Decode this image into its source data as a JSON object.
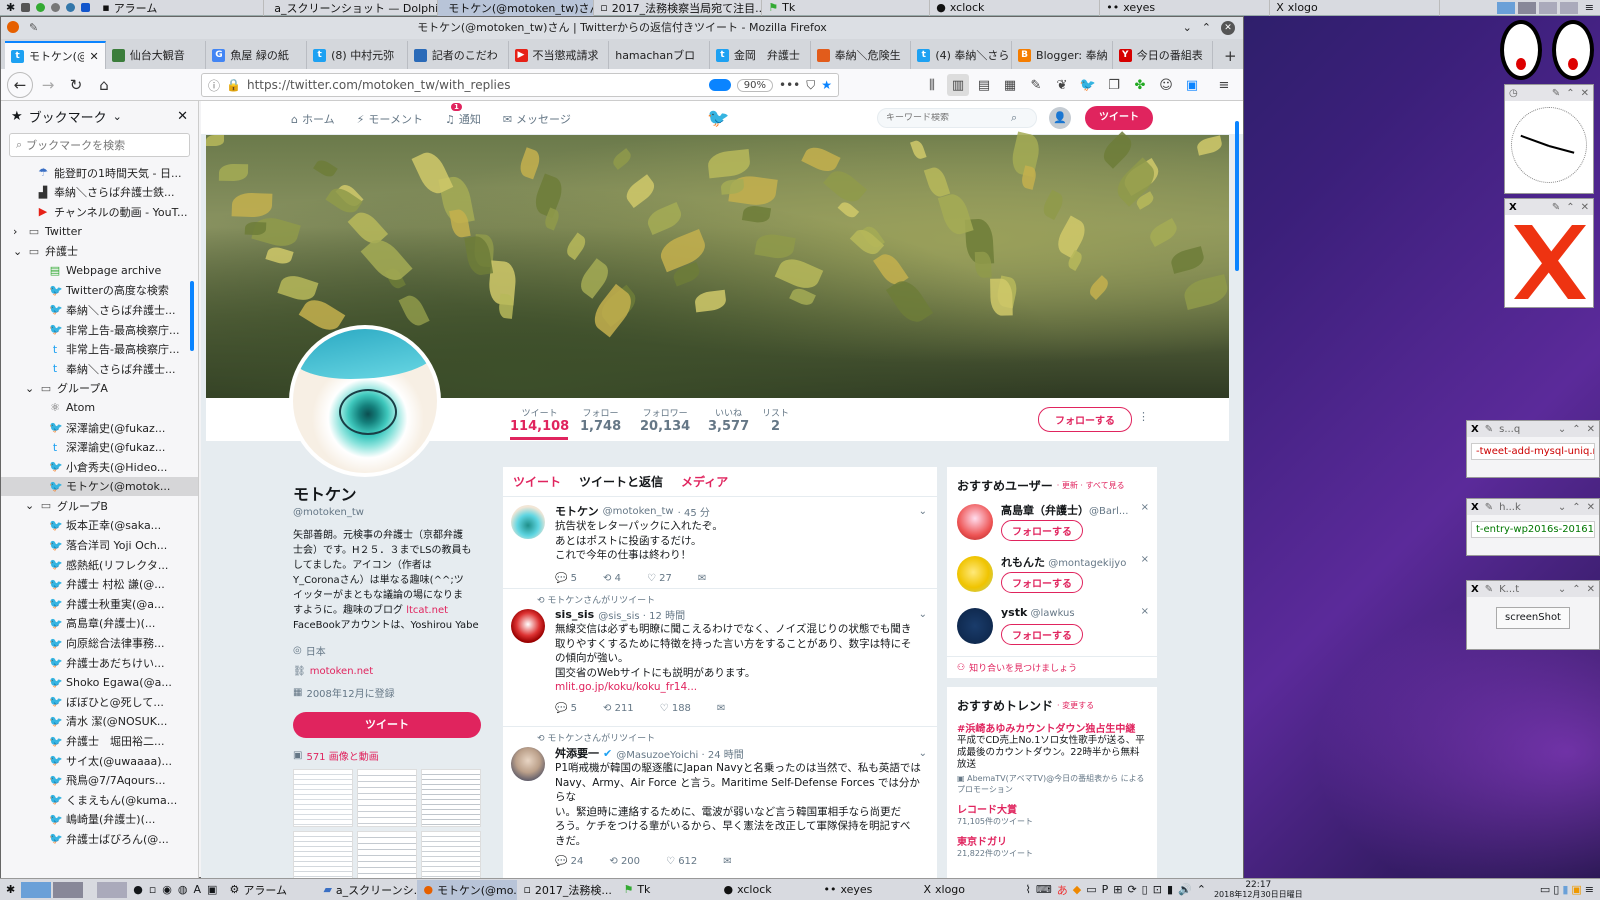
{
  "top_panel": {
    "tasks": [
      {
        "label": "アラーム"
      },
      {
        "label": "a_スクリーンショット — Dolphin"
      },
      {
        "label": "モトケン(@motoken_tw)さん ..."
      },
      {
        "label": "2017_法務検察当局宛て注目..."
      },
      {
        "label": "Tk"
      },
      {
        "label": "xclock"
      },
      {
        "label": "xeyes"
      },
      {
        "label": "xlogo"
      }
    ]
  },
  "window": {
    "title": "モトケン(@motoken_tw)さん | Twitterからの返信付きツイート - Mozilla Firefox"
  },
  "tabs": [
    {
      "label": "モトケン(@",
      "color": "#1da1f2"
    },
    {
      "label": "仙台大観音",
      "color": "#3b7d3b"
    },
    {
      "label": "魚屋 緑の紙",
      "color": "#4285f4"
    },
    {
      "label": "(8) 中村元弥",
      "color": "#1da1f2"
    },
    {
      "label": "記者のこだわ",
      "color": "#2a6ab8"
    },
    {
      "label": "不当懲戒請求",
      "color": "#e62117"
    },
    {
      "label": "hamachanブロ",
      "color": "#888888"
    },
    {
      "label": "金岡　弁護士",
      "color": "#1da1f2"
    },
    {
      "label": "奉納＼危険生",
      "color": "#e25c1b"
    },
    {
      "label": "(4) 奉納＼さら",
      "color": "#1da1f2"
    },
    {
      "label": "Blogger: 奉納",
      "color": "#f57d00"
    },
    {
      "label": "今日の番組表",
      "color": "#d60000"
    }
  ],
  "url": {
    "value": "https://twitter.com/motoken_tw/with_replies",
    "zoom": "90%"
  },
  "sidebar": {
    "title": "ブックマーク",
    "search_placeholder": "ブックマークを検索",
    "items": [
      {
        "label": "能登町の1時間天気 - 日...",
        "indent": 3,
        "icon": "weather"
      },
      {
        "label": "奉納＼さらば弁護士鉄...",
        "indent": 3,
        "icon": "chart"
      },
      {
        "label": "チャンネルの動画 - YouT...",
        "indent": 3,
        "icon": "youtube"
      },
      {
        "label": "Twitter",
        "indent": 2,
        "icon": "folder",
        "arrow": "›"
      },
      {
        "label": "弁護士",
        "indent": 2,
        "icon": "folder",
        "arrow": "⌄"
      },
      {
        "label": "Webpage archive",
        "indent": 4,
        "icon": "archive"
      },
      {
        "label": "Twitterの高度な検索",
        "indent": 4,
        "icon": "twitter"
      },
      {
        "label": "奉納＼さらば弁護士...",
        "indent": 4,
        "icon": "twitter"
      },
      {
        "label": "非常上告-最高検察庁...",
        "indent": 4,
        "icon": "twitter"
      },
      {
        "label": "非常上告-最高検察庁...",
        "indent": 4,
        "icon": "twitter-blue"
      },
      {
        "label": "奉納＼さらば弁護士...",
        "indent": 4,
        "icon": "twitter-blue"
      },
      {
        "label": "グループA",
        "indent": 3,
        "icon": "folder",
        "arrow": "⌄"
      },
      {
        "label": "Atom",
        "indent": 4,
        "icon": "atom"
      },
      {
        "label": "深澤諭史(@fukaz...",
        "indent": 4,
        "icon": "twitter"
      },
      {
        "label": "深澤諭史(@fukaz...",
        "indent": 4,
        "icon": "twitter-blue"
      },
      {
        "label": "小倉秀夫(@Hideo...",
        "indent": 4,
        "icon": "twitter"
      },
      {
        "label": "モトケン(@motok...",
        "indent": 4,
        "icon": "twitter",
        "selected": true
      },
      {
        "label": "グループB",
        "indent": 3,
        "icon": "folder",
        "arrow": "⌄"
      },
      {
        "label": "坂本正幸(@saka...",
        "indent": 4,
        "icon": "twitter"
      },
      {
        "label": "落合洋司 Yoji Och...",
        "indent": 4,
        "icon": "twitter"
      },
      {
        "label": "感熱紙(リフレクタ...",
        "indent": 4,
        "icon": "twitter"
      },
      {
        "label": "弁護士 村松 謙(@...",
        "indent": 4,
        "icon": "twitter"
      },
      {
        "label": "弁護士秋重実(@a...",
        "indent": 4,
        "icon": "twitter"
      },
      {
        "label": "高島章(弁護士)(...",
        "indent": 4,
        "icon": "twitter"
      },
      {
        "label": "向原総合法律事務...",
        "indent": 4,
        "icon": "twitter"
      },
      {
        "label": "弁護士あだちけい...",
        "indent": 4,
        "icon": "twitter"
      },
      {
        "label": "Shoko Egawa(@a...",
        "indent": 4,
        "icon": "twitter"
      },
      {
        "label": "ぼぼひと@死して...",
        "indent": 4,
        "icon": "twitter"
      },
      {
        "label": "清水 潔(@NOSUK...",
        "indent": 4,
        "icon": "twitter"
      },
      {
        "label": "弁護士　堀田裕二...",
        "indent": 4,
        "icon": "twitter"
      },
      {
        "label": "サイ太(@uwaaaa)...",
        "indent": 4,
        "icon": "twitter"
      },
      {
        "label": "飛鳥@7/7Aqours...",
        "indent": 4,
        "icon": "twitter"
      },
      {
        "label": "くまえもん(@kuma...",
        "indent": 4,
        "icon": "twitter"
      },
      {
        "label": "嶋崎量(弁護士)(...",
        "indent": 4,
        "icon": "twitter"
      },
      {
        "label": "弁護士ばびろん(@...",
        "indent": 4,
        "icon": "twitter"
      }
    ]
  },
  "twitter": {
    "nav": {
      "home": "ホーム",
      "moments": "モーメント",
      "notifications": "通知",
      "notif_count": "1",
      "messages": "メッセージ",
      "search_placeholder": "キーワード検索",
      "tweet_button": "ツイート"
    },
    "stats": [
      {
        "label": "ツイート",
        "value": "114,108"
      },
      {
        "label": "フォロー",
        "value": "1,748"
      },
      {
        "label": "フォロワー",
        "value": "20,134"
      },
      {
        "label": "いいね",
        "value": "3,577"
      },
      {
        "label": "リスト",
        "value": "2"
      }
    ],
    "follow_button": "フォローする",
    "profile": {
      "name": "モトケン",
      "handle": "@motoken_tw",
      "bio_lines": [
        "矢部善朗。元検事の弁護士（京都弁護",
        "士会）です。H２５．３までLSの教員も",
        "してました。アイコン（作者は",
        "Y_Coronaさん）は単なる趣味(^^;ツ",
        "イッターがまともな議論の場になりま",
        "すように。趣味のブログ"
      ],
      "bio_link": "ltcat.net",
      "bio_last": "FaceBookアカウントは、Yoshirou Yabe",
      "location": "日本",
      "website": "motoken.net",
      "joined": "2008年12月に登録",
      "tweet_button": "ツイート",
      "media_link": "571 画像と動画"
    },
    "timeline_tabs": [
      "ツイート",
      "ツイートと返信",
      "メディア"
    ],
    "tweets": [
      {
        "retweeted_by": "",
        "name": "モトケン",
        "handle": "@motoken_tw",
        "time": "· 45 分",
        "lines": [
          "抗告状をレターパックに入れたぞ。",
          "あとはポストに投函するだけ。",
          "これで今年の仕事は終わり！"
        ],
        "link": "",
        "replies": "5",
        "retweets": "4",
        "likes": "27"
      },
      {
        "retweeted_by": "モトケンさんがリツイート",
        "name": "sis_sis",
        "handle": "@sis_sis · 12 時間",
        "time": "",
        "lines": [
          "無線交信は必ずも明瞭に聞こえるわけでなく、ノイズ混じりの状態でも聞き",
          "取りやすくするために特徴を持った言い方をすることがあり、数字は特にそ",
          "の傾向が強い。",
          "国交省のWebサイトにも説明があります。"
        ],
        "link": "mlit.go.jp/koku/koku_fr14...",
        "replies": "5",
        "retweets": "211",
        "likes": "188"
      },
      {
        "retweeted_by": "モトケンさんがリツイート",
        "name": "舛添要一",
        "handle": "@MasuzoeYoichi · 24 時間",
        "time": "",
        "lines": [
          "P1哨戒機が韓国の駆逐艦にJapan Navyと名乗ったのは当然で、私も英語では",
          "Navy、Army、Air Force と言う。Maritime Self-Defense Forces では分からな",
          "い。緊迫時に連絡するために、電波が弱いなど言う韓国軍相手なら尚更だ",
          "ろう。ケチをつける輩がいるから、早く憲法を改正して軍隊保持を明記すべ",
          "きだ。"
        ],
        "link": "",
        "replies": "24",
        "retweets": "200",
        "likes": "612"
      }
    ],
    "who_to_follow": {
      "title": "おすすめユーザー",
      "links": "· 更新 · すべて見る",
      "users": [
        {
          "name": "高島章（弁護士）",
          "handle": "@Barl..."
        },
        {
          "name": "れもんた",
          "handle": "@montagekijyo"
        },
        {
          "name": "ystk",
          "handle": "@lawkus"
        }
      ],
      "follow_label": "フォローする",
      "find_friends": "知り合いを見つけましょう"
    },
    "trends": {
      "title": "おすすめトレンド",
      "change": "· 変更する",
      "items": [
        {
          "name": "#浜崎あゆみカウントダウン独占生中継",
          "desc": "平成でCD売上No.1ソロ女性歌手が送る、平成最後のカウントダウン。22時半から無料放送",
          "promo": "AbemaTV(アベマTV)@今日の番組表から によるプロモーション"
        },
        {
          "name": "レコード大賞",
          "count": "71,105件のツイート"
        },
        {
          "name": "東京ドガリ",
          "count": "21,822件のツイート"
        }
      ]
    }
  },
  "widgets": {
    "w1_title": "s...q",
    "w1_text": "-tweet-add-mysql-uniq.rb",
    "w2_title": "h...k",
    "w2_text": "t-entry-wp2016s-201610",
    "w3_title": "K...t",
    "w3_button": "screenShot"
  },
  "taskbar": {
    "tasks": [
      {
        "label": "アラーム"
      },
      {
        "label": "a_スクリーンシ..."
      },
      {
        "label": "モトケン(@mo..."
      },
      {
        "label": "2017_法務検..."
      },
      {
        "label": "Tk"
      },
      {
        "label": "xclock"
      },
      {
        "label": "xeyes"
      },
      {
        "label": "xlogo"
      }
    ],
    "clock_time": "22:17",
    "clock_date": "2018年12月30日日曜日"
  }
}
